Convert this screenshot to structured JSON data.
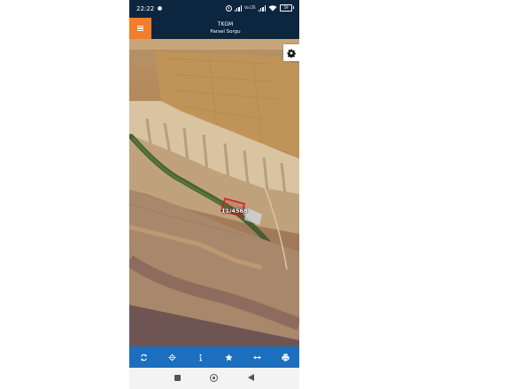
{
  "statusbar": {
    "time": "22:22",
    "net_label": "Vo LTE",
    "battery": "59"
  },
  "header": {
    "title": "TKGM",
    "subtitle": "Parsel Sorgu"
  },
  "map": {
    "parcel_label": "11/4568"
  },
  "toolbar": {
    "icons": [
      "refresh-icon",
      "locate-icon",
      "info-icon",
      "star-icon",
      "measure-icon",
      "print-icon"
    ]
  },
  "colors": {
    "header_bg": "#0d2640",
    "menu_accent": "#f57c28",
    "toolbar_bg": "#1b6fbe",
    "parcel_outline": "#d11f2a"
  }
}
